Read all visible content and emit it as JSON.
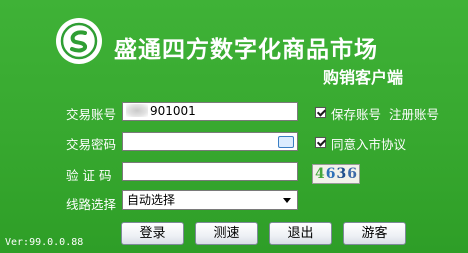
{
  "header": {
    "title": "盛通四方数字化商品市场",
    "subtitle": "购销客户端"
  },
  "form": {
    "account": {
      "label": "交易账号",
      "value": "901001"
    },
    "password": {
      "label": "交易密码",
      "value": ""
    },
    "captcha": {
      "label": "验 证 码",
      "value": "",
      "code": "4636"
    },
    "route": {
      "label": "线路选择",
      "selected": "自动选择"
    }
  },
  "options": {
    "save_account": {
      "label": "保存账号",
      "checked": true
    },
    "agree": {
      "label": "同意入市协议",
      "checked": true
    },
    "register_link": "注册账号"
  },
  "buttons": {
    "login": "登录",
    "speed_test": "测速",
    "exit": "退出",
    "guest": "游客"
  },
  "footer": {
    "version": "Ver:99.0.0.88"
  },
  "colors": {
    "background": "#37a82f",
    "logo": "#2f9e34"
  }
}
